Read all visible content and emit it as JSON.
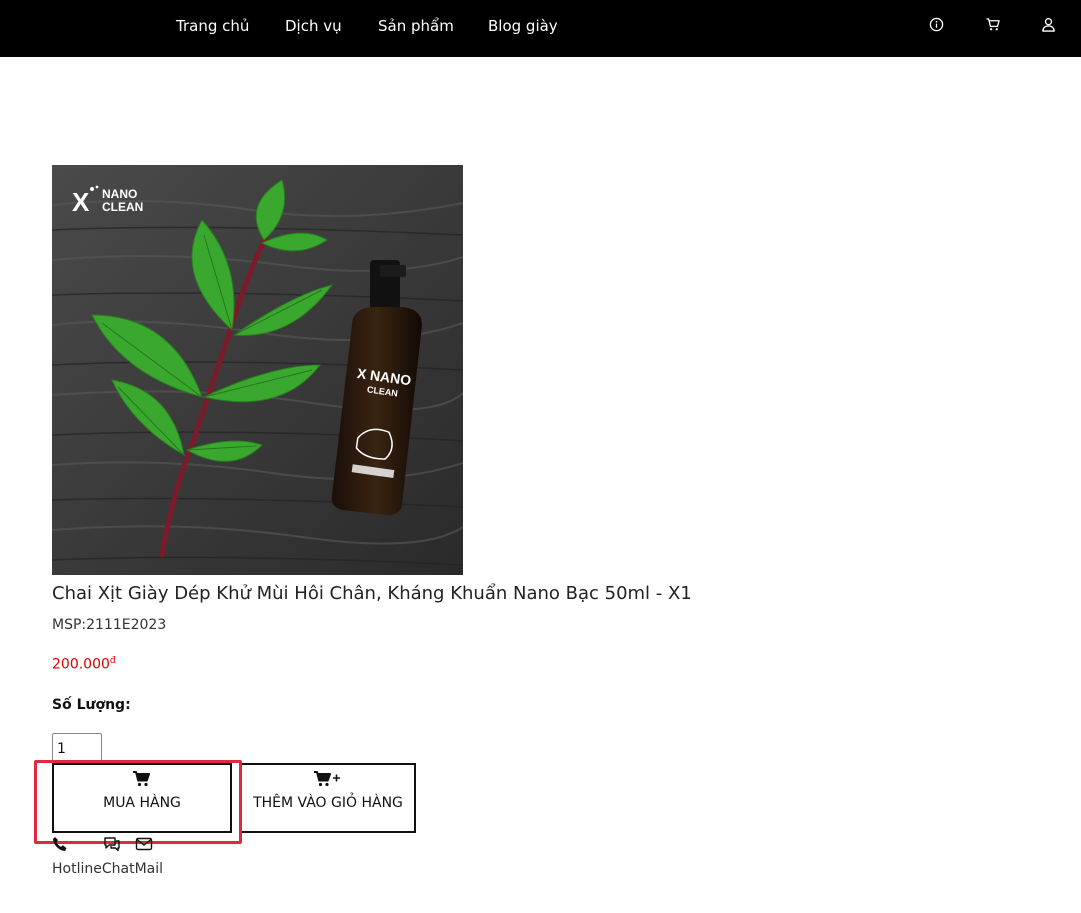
{
  "nav": {
    "items": [
      {
        "label": "Trang chủ"
      },
      {
        "label": "Dịch vụ"
      },
      {
        "label": "Sản phẩm"
      },
      {
        "label": "Blog giày"
      }
    ],
    "icons": [
      "info-icon",
      "cart-icon",
      "user-icon"
    ]
  },
  "product": {
    "image_brand_text": "NANO CLEAN",
    "title": "Chai Xịt Giày Dép Khử Mùi Hôi Chân, Kháng Khuẩn Nano Bạc 50ml - X1",
    "sku": "MSP:2111E2023",
    "price": "200.000",
    "currency_symbol": "đ",
    "quantity_label": "Số Lượng:",
    "quantity_value": "1"
  },
  "actions": {
    "buy_label": "MUA HÀNG",
    "add_to_cart_label": "THÊM VÀO GIỎ HÀNG"
  },
  "contact": {
    "hotline": "Hotline",
    "chat": "Chat",
    "mail": "Mail"
  },
  "colors": {
    "nav_bg": "#000000",
    "price": "#e00000",
    "highlight": "#e0283e"
  }
}
